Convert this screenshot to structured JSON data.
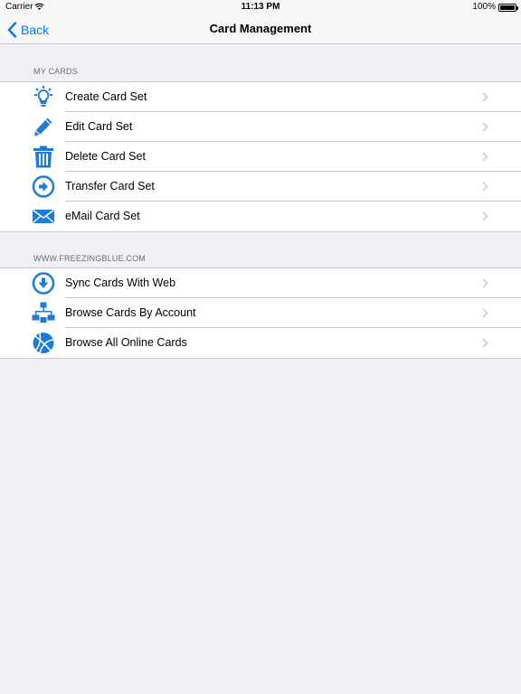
{
  "status_bar": {
    "carrier": "Carrier",
    "time": "11:13 PM",
    "battery": "100%"
  },
  "nav": {
    "back_label": "Back",
    "title": "Card Management"
  },
  "sections": [
    {
      "header": "MY CARDS",
      "items": [
        {
          "label": "Create Card Set",
          "icon": "lightbulb-icon"
        },
        {
          "label": "Edit Card Set",
          "icon": "pencil-icon"
        },
        {
          "label": "Delete Card Set",
          "icon": "trash-icon"
        },
        {
          "label": "Transfer Card Set",
          "icon": "arrow-circle-icon"
        },
        {
          "label": "eMail Card Set",
          "icon": "envelope-icon"
        }
      ]
    },
    {
      "header": "WWW.FREEZINGBLUE.COM",
      "items": [
        {
          "label": "Sync Cards With Web",
          "icon": "download-circle-icon"
        },
        {
          "label": "Browse Cards By Account",
          "icon": "hierarchy-icon"
        },
        {
          "label": "Browse All Online Cards",
          "icon": "globe-ball-icon"
        }
      ]
    }
  ],
  "colors": {
    "accent": "#007aff",
    "icon_blue": "#1e7bd8",
    "background": "#efeff4"
  }
}
